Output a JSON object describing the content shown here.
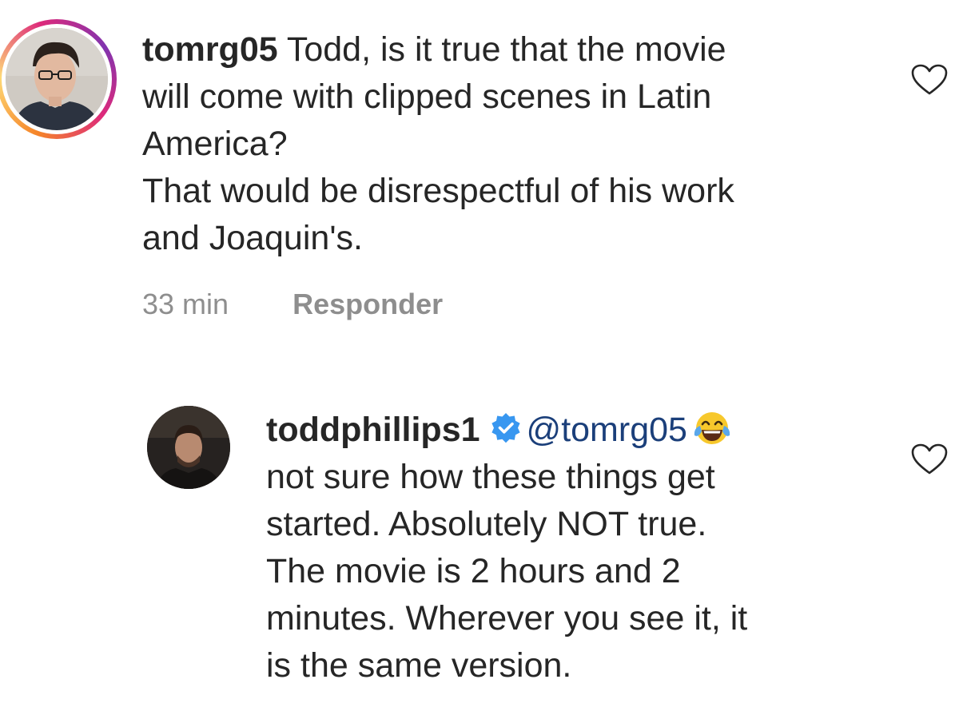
{
  "comments": [
    {
      "username": "tomrg05",
      "lines": [
        "Todd, is it true that the movie",
        "will come with clipped scenes in Latin",
        "America?",
        "That would be disrespectful of his work",
        "and Joaquin's."
      ],
      "time": "33 min",
      "reply_label": "Responder",
      "avatar_icon": "user-avatar",
      "story_ring": true
    },
    {
      "username": "toddphillips1",
      "verified": true,
      "mention": "@tomrg05",
      "emoji": "face-with-tears-of-joy",
      "lines": [
        "not sure how these things get",
        "started. Absolutely NOT true.",
        "The movie is 2 hours and 2",
        "minutes. Wherever you see it, it",
        "is the same version."
      ],
      "avatar_icon": "user-avatar"
    }
  ],
  "colors": {
    "text": "#262626",
    "meta": "#8e8e8e",
    "mention": "#1b3f7a",
    "verified": "#3897f0"
  }
}
